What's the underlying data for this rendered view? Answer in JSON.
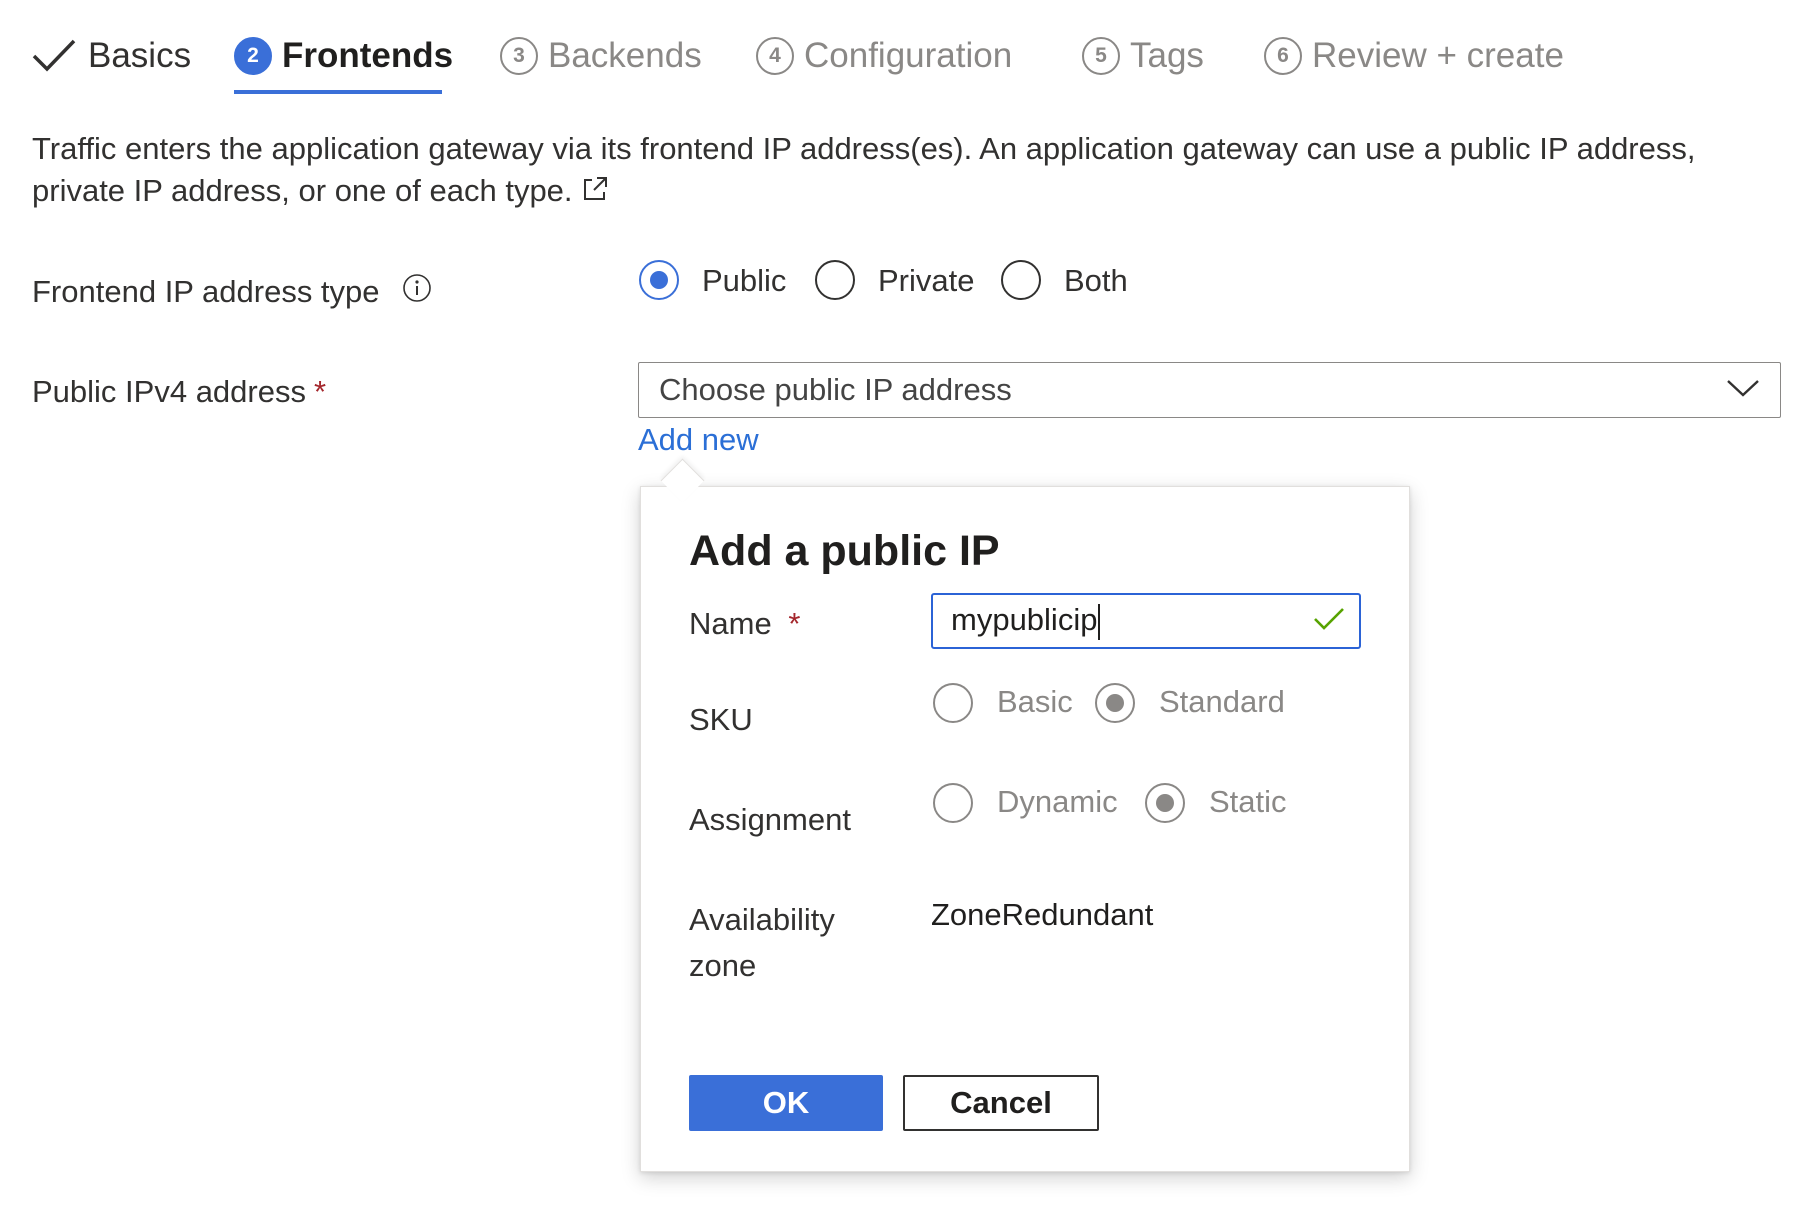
{
  "wizard": {
    "tabs": [
      {
        "label": "Basics",
        "step": "",
        "state": "done"
      },
      {
        "label": "Frontends",
        "step": "2",
        "state": "active"
      },
      {
        "label": "Backends",
        "step": "3",
        "state": "pending"
      },
      {
        "label": "Configuration",
        "step": "4",
        "state": "pending"
      },
      {
        "label": "Tags",
        "step": "5",
        "state": "pending"
      },
      {
        "label": "Review + create",
        "step": "6",
        "state": "pending"
      }
    ]
  },
  "description": "Traffic enters the application gateway via its frontend IP address(es). An application gateway can use a public IP address, private IP address, or one of each type.",
  "frontend_ip_type": {
    "label": "Frontend IP address type",
    "options": [
      "Public",
      "Private",
      "Both"
    ],
    "selected": "Public"
  },
  "public_ipv4": {
    "label": "Public IPv4 address",
    "required_mark": "*",
    "placeholder": "Choose public IP address",
    "add_new_label": "Add new"
  },
  "callout": {
    "title": "Add a public IP",
    "name_label": "Name",
    "name_required_mark": "*",
    "name_value": "mypublicip",
    "sku_label": "SKU",
    "sku_options": [
      "Basic",
      "Standard"
    ],
    "sku_selected": "Standard",
    "assignment_label": "Assignment",
    "assignment_options": [
      "Dynamic",
      "Static"
    ],
    "assignment_selected": "Static",
    "zone_label": "Availability zone",
    "zone_value": "ZoneRedundant",
    "ok_label": "OK",
    "cancel_label": "Cancel"
  },
  "colors": {
    "accent": "#3a6fd8",
    "link": "#2b6fd6",
    "required": "#a4262c",
    "valid_check": "#57a300",
    "disabled": "#8a8886"
  }
}
